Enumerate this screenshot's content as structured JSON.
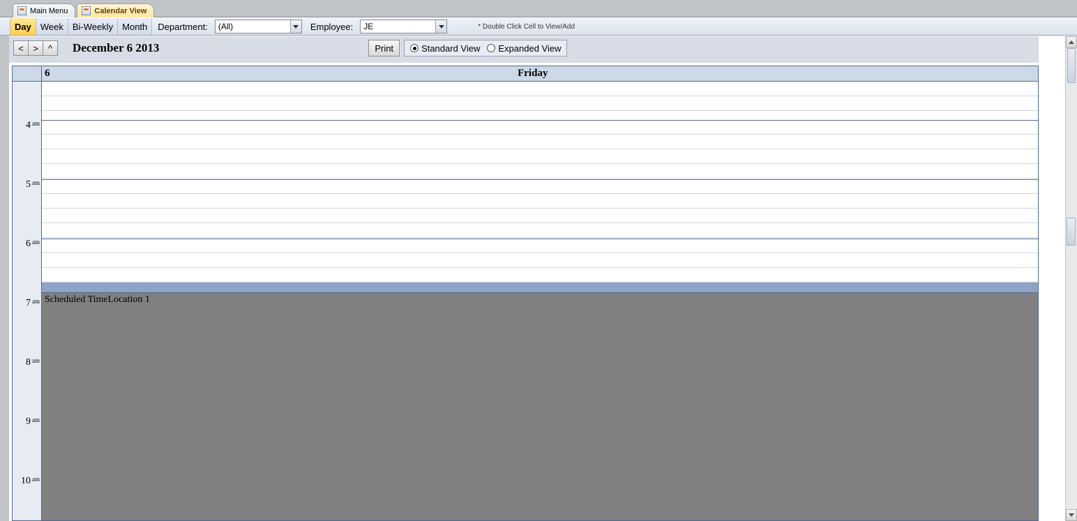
{
  "tabs": [
    {
      "label": "Main Menu",
      "active": false
    },
    {
      "label": "Calendar View",
      "active": true
    }
  ],
  "viewModes": {
    "day": "Day",
    "week": "Week",
    "biweekly": "Bi-Weekly",
    "month": "Month"
  },
  "filters": {
    "departmentLabel": "Department:",
    "departmentValue": "(All)",
    "employeeLabel": "Employee:",
    "employeeValue": "JE"
  },
  "hint": "* Double Click Cell to View/Add",
  "nav": {
    "prev": "<",
    "next": ">",
    "today": "^",
    "dateLabel": "December 6 2013",
    "print": "Print",
    "standard": "Standard View",
    "expanded": "Expanded View"
  },
  "dayHeader": {
    "dayNum": "6",
    "dayName": "Friday"
  },
  "hours": [
    {
      "h": "4",
      "ap": "am"
    },
    {
      "h": "5",
      "ap": "am"
    },
    {
      "h": "6",
      "ap": "am"
    },
    {
      "h": "7",
      "ap": "am"
    },
    {
      "h": "8",
      "ap": "am"
    },
    {
      "h": "9",
      "ap": "am"
    },
    {
      "h": "10",
      "ap": "am"
    }
  ],
  "event": {
    "title": "Scheduled TimeLocation 1"
  }
}
